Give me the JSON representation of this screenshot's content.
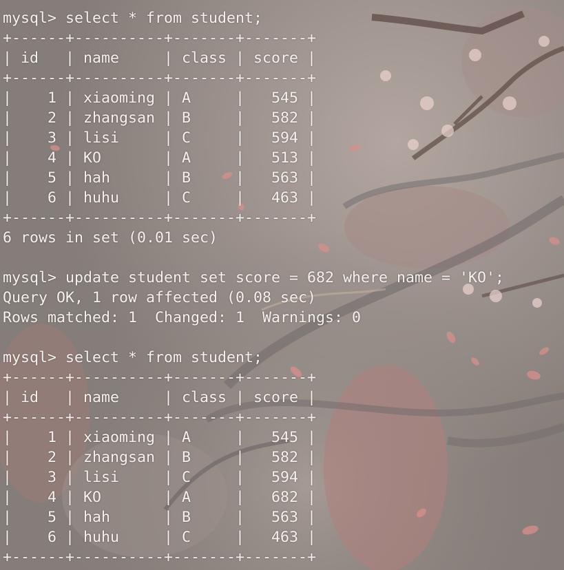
{
  "terminal": {
    "lines": [
      "mysql> select * from student;",
      "+------+----------+-------+-------+",
      "| id   | name     | class | score |",
      "+------+----------+-------+-------+",
      "|    1 | xiaoming | A     |   545 |",
      "|    2 | zhangsan | B     |   582 |",
      "|    3 | lisi     | C     |   594 |",
      "|    4 | KO       | A     |   513 |",
      "|    5 | hah      | B     |   563 |",
      "|    6 | huhu     | C     |   463 |",
      "+------+----------+-------+-------+",
      "6 rows in set (0.01 sec)",
      "",
      "mysql> update student set score = 682 where name = 'KO';",
      "Query OK, 1 row affected (0.08 sec)",
      "Rows matched: 1  Changed: 1  Warnings: 0",
      "",
      "mysql> select * from student;",
      "+------+----------+-------+-------+",
      "| id   | name     | class | score |",
      "+------+----------+-------+-------+",
      "|    1 | xiaoming | A     |   545 |",
      "|    2 | zhangsan | B     |   582 |",
      "|    3 | lisi     | C     |   594 |",
      "|    4 | KO       | A     |   682 |",
      "|    5 | hah      | B     |   563 |",
      "|    6 | huhu     | C     |   463 |",
      "+------+----------+-------+-------+"
    ]
  },
  "colors": {
    "text": "#f4f1ee",
    "background_base": "#8d8580",
    "petal": "#d98f8a",
    "blossom_light": "#ecd3cf",
    "branch": "#5e4a45",
    "ribbon": "#6e6a6c"
  },
  "wallpaper_icon": "cherry-blossom-wallpaper-icon"
}
